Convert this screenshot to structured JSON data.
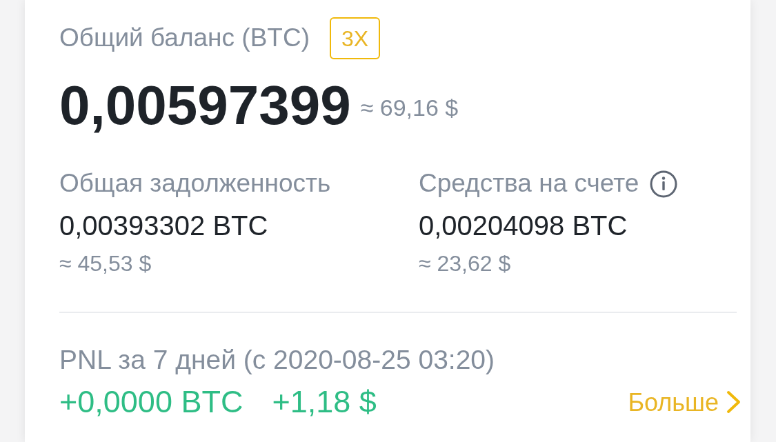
{
  "balance": {
    "label": "Общий баланс (BTC)",
    "leverage_badge": "3X",
    "amount": "0,00597399",
    "approx": "≈ 69,16 $"
  },
  "stats": [
    {
      "label": "Общая задолженность",
      "info": false,
      "value": "0,00393302 BTC",
      "approx": "≈ 45,53 $"
    },
    {
      "label": "Средства на счете",
      "info": true,
      "value": "0,00204098 BTC",
      "approx": "≈ 23,62 $"
    }
  ],
  "pnl": {
    "label": "PNL за 7 дней (с 2020-08-25 03:20)",
    "values": [
      "+0,0000 BTC",
      "+1,18 $"
    ],
    "more_link": "Больше"
  }
}
